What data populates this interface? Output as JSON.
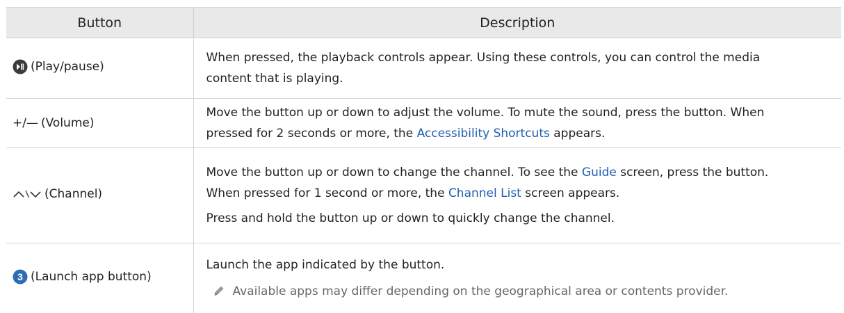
{
  "header": {
    "col_button": "Button",
    "col_description": "Description"
  },
  "rows": [
    {
      "button_icon": "play-pause-icon",
      "button_label": "(Play/pause)",
      "desc_line1": "When pressed, the playback controls appear. Using these controls, you can control the media",
      "desc_line2": "content that is playing."
    },
    {
      "button_symbol": "+/—",
      "button_label": "(Volume)",
      "desc_line1": "Move the button up or down to adjust the volume. To mute the sound, press the button. When",
      "desc_line2_pre": "pressed for 2 seconds or more, the ",
      "desc_line2_link": "Accessibility Shortcuts",
      "desc_line2_post": " appears."
    },
    {
      "button_icon": "chevron-up-down-icon",
      "button_label": "(Channel)",
      "desc_line1_pre": "Move the button up or down to change the channel. To see the ",
      "desc_line1_link": "Guide",
      "desc_line1_post": " screen, press the button.",
      "desc_line2_pre": "When pressed for 1 second or more, the ",
      "desc_line2_link": "Channel List",
      "desc_line2_post": " screen appears.",
      "desc_line3": "Press and hold the button up or down to quickly change the channel."
    },
    {
      "button_icon_digit": "3",
      "button_label": "(Launch app button)",
      "desc_line1": "Launch the app indicated by the button.",
      "note_icon": "pencil-icon",
      "note_text": "Available apps may differ depending on the geographical area or contents provider."
    }
  ],
  "colors": {
    "header_bg": "#e9e9e9",
    "link": "#1f5fae",
    "icon_blue": "#2d6db5",
    "icon_dark": "#3a3a3a"
  }
}
